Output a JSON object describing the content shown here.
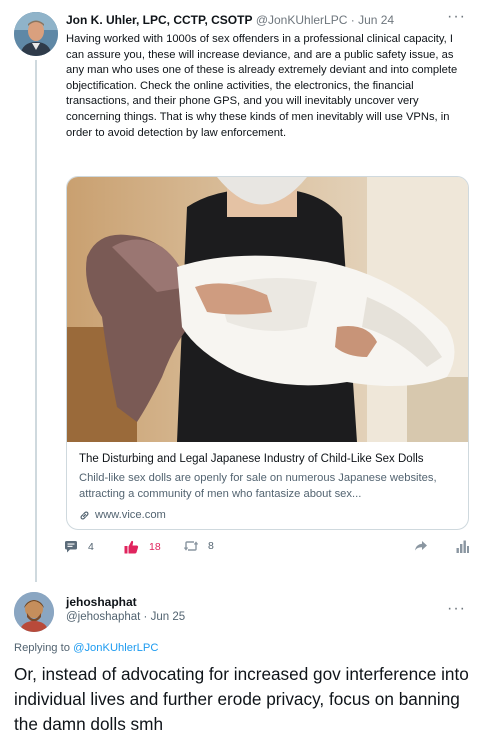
{
  "tweet": {
    "author_name": "Jon K. Uhler, LPC, CCTP, CSOTP",
    "author_handle": "@JonKUhlerLPC",
    "separator": " · ",
    "date": "Jun 24",
    "text": "Having worked with 1000s of sex offenders in a professional clinical capacity, I can assure you, these will increase deviance, and are a public safety issue, as any man who uses one of these is already extremely deviant and into complete objectification. Check the online activities, the electronics, the financial transactions, and their phone GPS, and you will inevitably uncover very concerning things. That is why these kinds of men inevitably will use VPNs, in order to avoid detection by law enforcement.",
    "card": {
      "title": "The Disturbing and Legal Japanese Industry of Child-Like Sex Dolls",
      "description": "Child-like sex dolls are openly for sale on numerous Japanese websites, attracting a community of men who fantasize about sex...",
      "domain": "www.vice.com"
    },
    "actions": {
      "replies": "4",
      "likes": "18",
      "retweets": "8"
    },
    "icons": [
      "avatar",
      "more-icon",
      "link-icon",
      "reply-icon",
      "like-icon",
      "retweet-icon",
      "share-icon",
      "analytics-icon"
    ]
  },
  "reply": {
    "author_name": "jehoshaphat",
    "author_handle": "@jehoshaphat",
    "separator": " · ",
    "date": "Jun 25",
    "replying_prefix": "Replying to ",
    "replying_handle": "@JonKUhlerLPC",
    "text": "Or, instead of advocating for increased gov interference into individual lives and further erode privacy, focus on banning the damn dolls smh"
  },
  "colors": {
    "like_active": "#e0245e",
    "link_blue": "#1d9bf0",
    "secondary_text": "#536471",
    "border": "#cfd9de"
  }
}
